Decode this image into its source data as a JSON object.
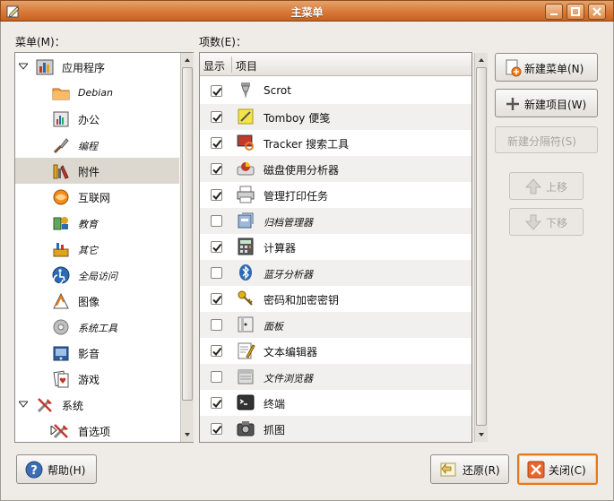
{
  "window": {
    "title": "主菜单"
  },
  "labels": {
    "menus": "菜单(M)：",
    "items": "项数(E)："
  },
  "tree": [
    {
      "label": "应用程序",
      "level": 0,
      "expander": "expanded",
      "icon": "applications-icon",
      "italic": false
    },
    {
      "label": "Debian",
      "level": 1,
      "icon": "folder-icon",
      "italic": true
    },
    {
      "label": "办公",
      "level": 1,
      "icon": "office-icon",
      "italic": false
    },
    {
      "label": "编程",
      "level": 1,
      "icon": "programming-icon",
      "italic": true
    },
    {
      "label": "附件",
      "level": 1,
      "icon": "accessories-icon",
      "italic": false,
      "selected": true
    },
    {
      "label": "互联网",
      "level": 1,
      "icon": "internet-icon",
      "italic": false
    },
    {
      "label": "教育",
      "level": 1,
      "icon": "education-icon",
      "italic": true
    },
    {
      "label": "其它",
      "level": 1,
      "icon": "other-icon",
      "italic": true
    },
    {
      "label": "全局访问",
      "level": 1,
      "icon": "accessibility-icon",
      "italic": true
    },
    {
      "label": "图像",
      "level": 1,
      "icon": "graphics-icon",
      "italic": false
    },
    {
      "label": "系统工具",
      "level": 1,
      "icon": "system-tools-icon",
      "italic": true
    },
    {
      "label": "影音",
      "level": 1,
      "icon": "multimedia-icon",
      "italic": false
    },
    {
      "label": "游戏",
      "level": 1,
      "icon": "games-icon",
      "italic": false
    },
    {
      "label": "系统",
      "level": 0,
      "expander": "expanded",
      "icon": "system-icon",
      "italic": false
    },
    {
      "label": "首选项",
      "level": 1,
      "expander": "collapsed",
      "icon": "preferences-icon",
      "italic": false
    }
  ],
  "items_header": {
    "show": "显示",
    "item": "项目"
  },
  "items": [
    {
      "label": "Scrot",
      "checked": true,
      "icon": "scrot-icon",
      "italic": false
    },
    {
      "label": "Tomboy 便笺",
      "checked": true,
      "icon": "tomboy-icon",
      "italic": false
    },
    {
      "label": "Tracker 搜索工具",
      "checked": true,
      "icon": "tracker-search-icon",
      "italic": false
    },
    {
      "label": "磁盘使用分析器",
      "checked": true,
      "icon": "disk-usage-icon",
      "italic": false
    },
    {
      "label": "管理打印任务",
      "checked": true,
      "icon": "printer-icon",
      "italic": false
    },
    {
      "label": "归档管理器",
      "checked": false,
      "icon": "archive-manager-icon",
      "italic": true
    },
    {
      "label": "计算器",
      "checked": true,
      "icon": "calculator-icon",
      "italic": false
    },
    {
      "label": "蓝牙分析器",
      "checked": false,
      "icon": "bluetooth-icon",
      "italic": true
    },
    {
      "label": "密码和加密密钥",
      "checked": true,
      "icon": "keys-icon",
      "italic": false
    },
    {
      "label": "面板",
      "checked": false,
      "icon": "panel-icon",
      "italic": true
    },
    {
      "label": "文本编辑器",
      "checked": true,
      "icon": "text-editor-icon",
      "italic": false
    },
    {
      "label": "文件浏览器",
      "checked": false,
      "icon": "file-browser-icon",
      "italic": true
    },
    {
      "label": "终端",
      "checked": true,
      "icon": "terminal-icon",
      "italic": false
    },
    {
      "label": "抓图",
      "checked": true,
      "icon": "screenshot-icon",
      "italic": false
    }
  ],
  "buttons": {
    "new_menu": "新建菜单(N)",
    "new_item": "新建项目(W)",
    "new_separator": "新建分隔符(S)",
    "move_up": "上移",
    "move_down": "下移",
    "help": "帮助(H)",
    "revert": "还原(R)",
    "close": "关闭(C)"
  }
}
